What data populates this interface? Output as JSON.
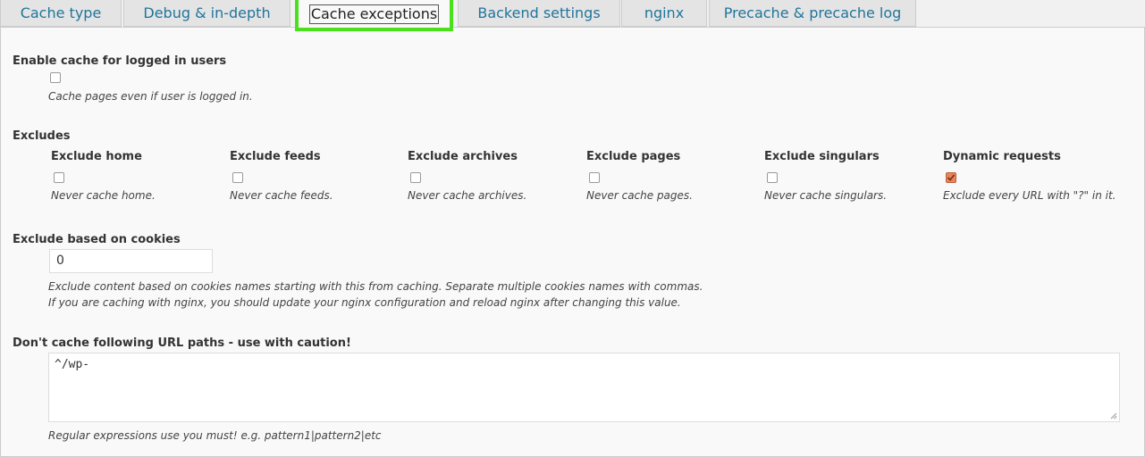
{
  "tabs": [
    {
      "label": "Cache type"
    },
    {
      "label": "Debug & in-depth"
    },
    {
      "label": "Cache exceptions"
    },
    {
      "label": "Backend settings"
    },
    {
      "label": "nginx"
    },
    {
      "label": "Precache & precache log"
    }
  ],
  "active_tab": "Cache exceptions",
  "logged_in": {
    "title": "Enable cache for logged in users",
    "checked": false,
    "description": "Cache pages even if user is logged in."
  },
  "excludes": {
    "title": "Excludes",
    "items": [
      {
        "label": "Exclude home",
        "checked": false,
        "description": "Never cache home."
      },
      {
        "label": "Exclude feeds",
        "checked": false,
        "description": "Never cache feeds."
      },
      {
        "label": "Exclude archives",
        "checked": false,
        "description": "Never cache archives."
      },
      {
        "label": "Exclude pages",
        "checked": false,
        "description": "Never cache pages."
      },
      {
        "label": "Exclude singulars",
        "checked": false,
        "description": "Never cache singulars."
      },
      {
        "label": "Dynamic requests",
        "checked": true,
        "description": "Exclude every URL with \"?\" in it."
      }
    ]
  },
  "cookies": {
    "title": "Exclude based on cookies",
    "value": "0",
    "description_line1": "Exclude content based on cookies names starting with this from caching. Separate multiple cookies names with commas.",
    "description_line2": "If you are caching with nginx, you should update your nginx configuration and reload nginx after changing this value."
  },
  "url_paths": {
    "title": "Don't cache following URL paths - use with caution!",
    "value": "^/wp-",
    "description": "Regular expressions use you must! e.g. pattern1|pattern2|etc"
  },
  "colors": {
    "tab_text": "#21759b",
    "active_highlight": "#4be01e",
    "checked_box": "#e8845a"
  }
}
